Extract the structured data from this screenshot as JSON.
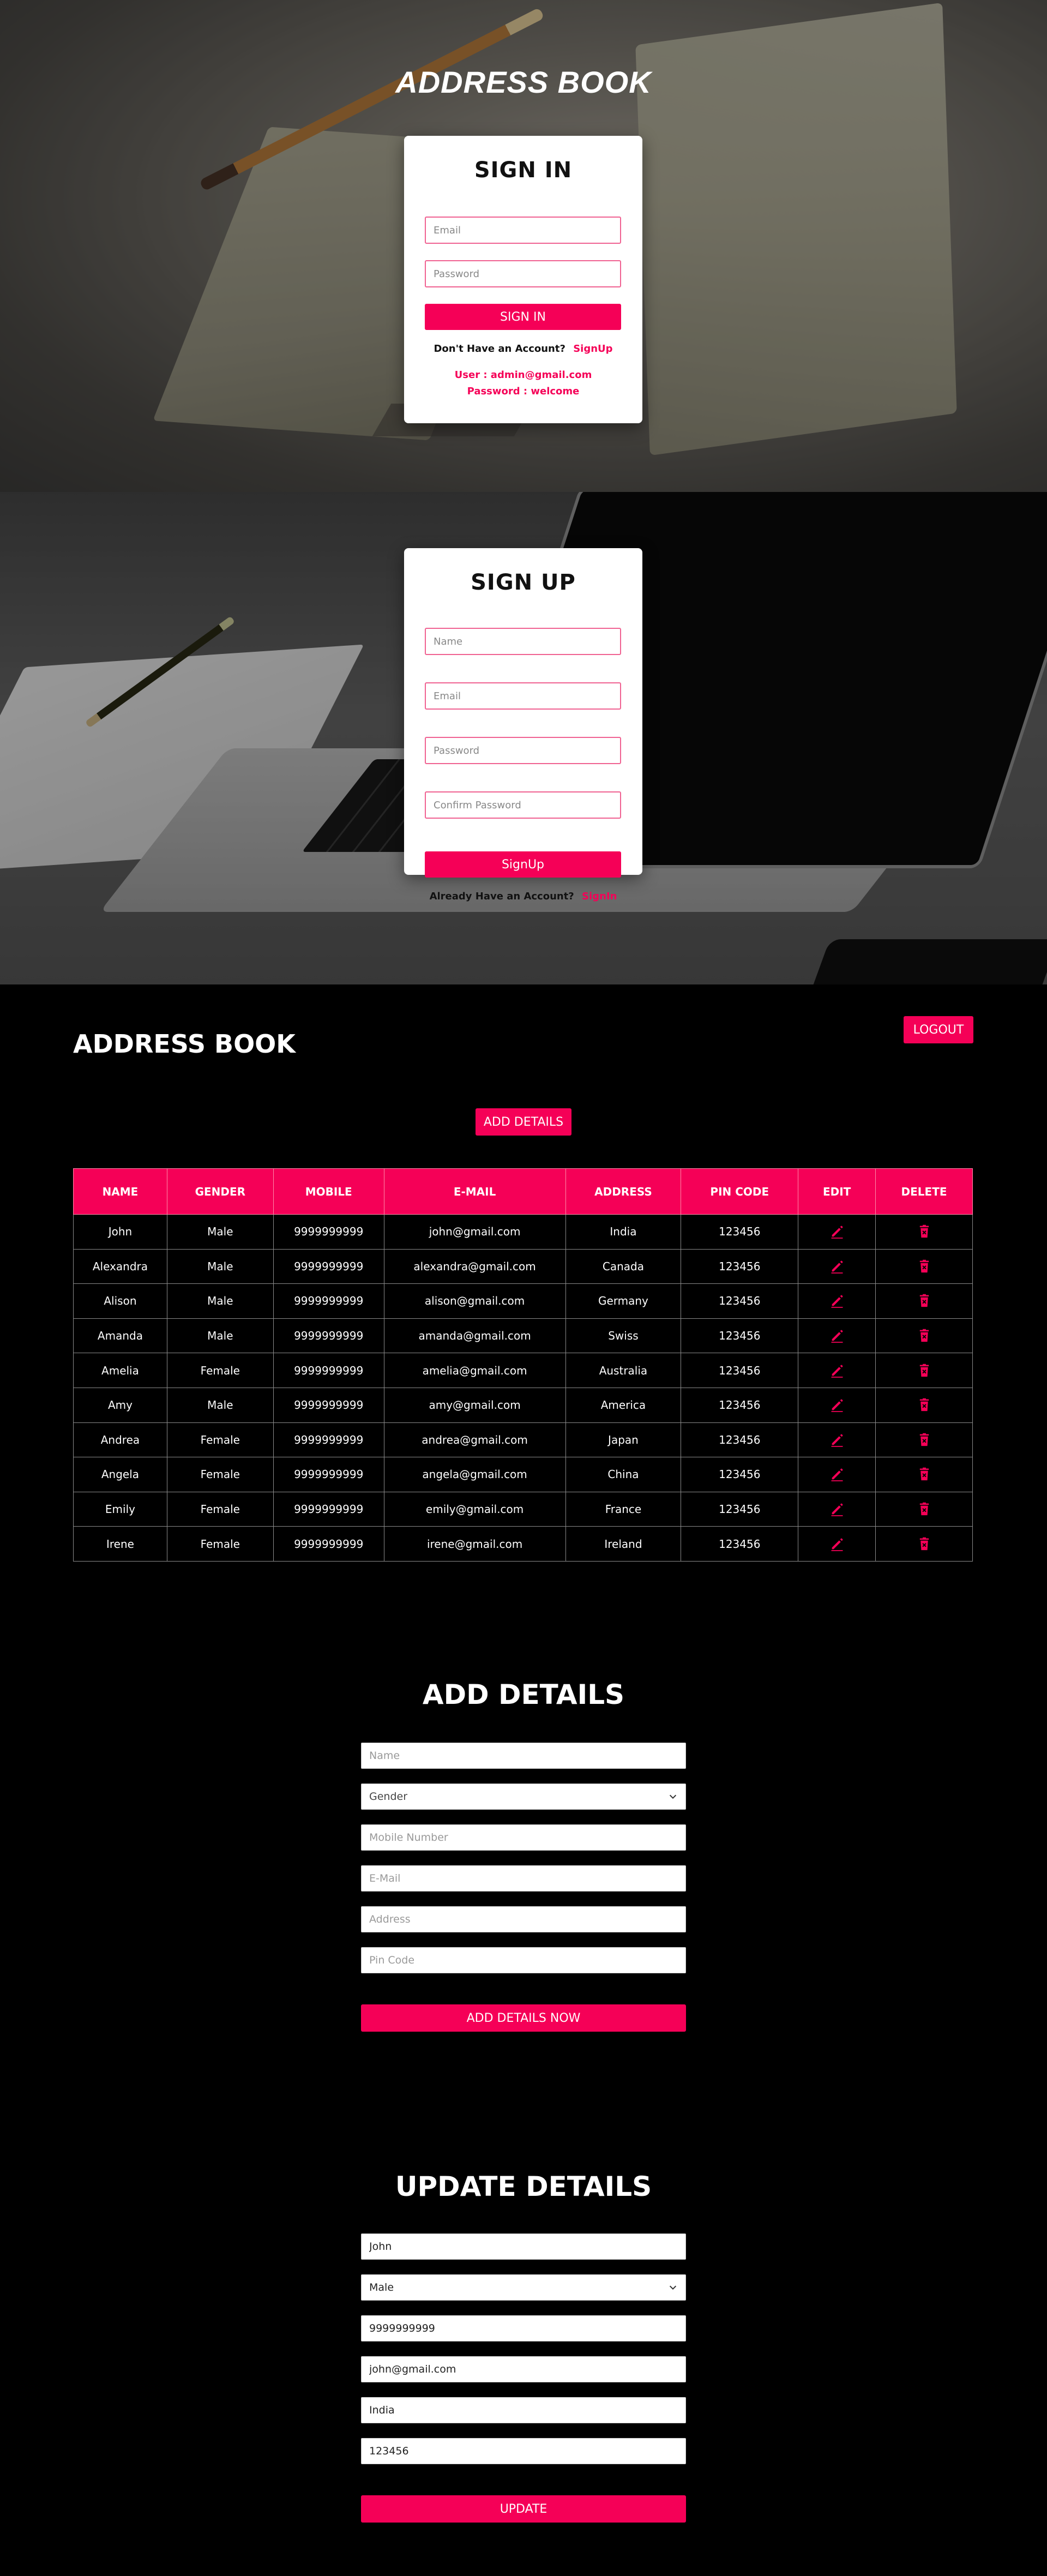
{
  "signin": {
    "site_title": "ADDRESS BOOK",
    "heading": "SIGN IN",
    "email_placeholder": "Email",
    "password_placeholder": "Password",
    "button_label": "SIGN IN",
    "prompt_text": "Don't Have an Account?",
    "switch_link": "SignUp",
    "demo_user": "User : admin@gmail.com",
    "demo_password": "Password : welcome"
  },
  "signup": {
    "heading": "SIGN UP",
    "name_placeholder": "Name",
    "email_placeholder": "Email",
    "password_placeholder": "Password",
    "confirm_placeholder": "Confirm Password",
    "button_label": "SignUp",
    "prompt_text": "Already Have an Account?",
    "switch_link": "SignIn"
  },
  "address_book": {
    "title": "ADDRESS BOOK",
    "logout_label": "LOGOUT",
    "add_details_label": "ADD DETAILS",
    "columns": [
      "NAME",
      "GENDER",
      "MOBILE",
      "E-MAIL",
      "ADDRESS",
      "PIN CODE",
      "EDIT",
      "DELETE"
    ],
    "rows": [
      [
        "John",
        "Male",
        "9999999999",
        "john@gmail.com",
        "India",
        "123456"
      ],
      [
        "Alexandra",
        "Male",
        "9999999999",
        "alexandra@gmail.com",
        "Canada",
        "123456"
      ],
      [
        "Alison",
        "Male",
        "9999999999",
        "alison@gmail.com",
        "Germany",
        "123456"
      ],
      [
        "Amanda",
        "Male",
        "9999999999",
        "amanda@gmail.com",
        "Swiss",
        "123456"
      ],
      [
        "Amelia",
        "Female",
        "9999999999",
        "amelia@gmail.com",
        "Australia",
        "123456"
      ],
      [
        "Amy",
        "Male",
        "9999999999",
        "amy@gmail.com",
        "America",
        "123456"
      ],
      [
        "Andrea",
        "Female",
        "9999999999",
        "andrea@gmail.com",
        "Japan",
        "123456"
      ],
      [
        "Angela",
        "Female",
        "9999999999",
        "angela@gmail.com",
        "China",
        "123456"
      ],
      [
        "Emily",
        "Female",
        "9999999999",
        "emily@gmail.com",
        "France",
        "123456"
      ],
      [
        "Irene",
        "Female",
        "9999999999",
        "irene@gmail.com",
        "Ireland",
        "123456"
      ]
    ],
    "edit_icon": "pencil-icon",
    "delete_icon": "trash-icon"
  },
  "add_form": {
    "heading": "ADD DETAILS",
    "name_placeholder": "Name",
    "gender_selected": "Gender",
    "mobile_placeholder": "Mobile Number",
    "email_placeholder": "E-Mail",
    "address_placeholder": "Address",
    "pincode_placeholder": "Pin Code",
    "button_label": "ADD DETAILS NOW"
  },
  "update_form": {
    "heading": "UPDATE DETAILS",
    "name_value": "John",
    "gender_selected": "Male",
    "mobile_value": "9999999999",
    "email_value": "john@gmail.com",
    "address_value": "India",
    "pincode_value": "123456",
    "button_label": "UPDATE"
  },
  "colors": {
    "accent": "#f50057",
    "accent_border": "#f06292",
    "page_bg": "#000000",
    "card_bg": "#ffffff"
  }
}
